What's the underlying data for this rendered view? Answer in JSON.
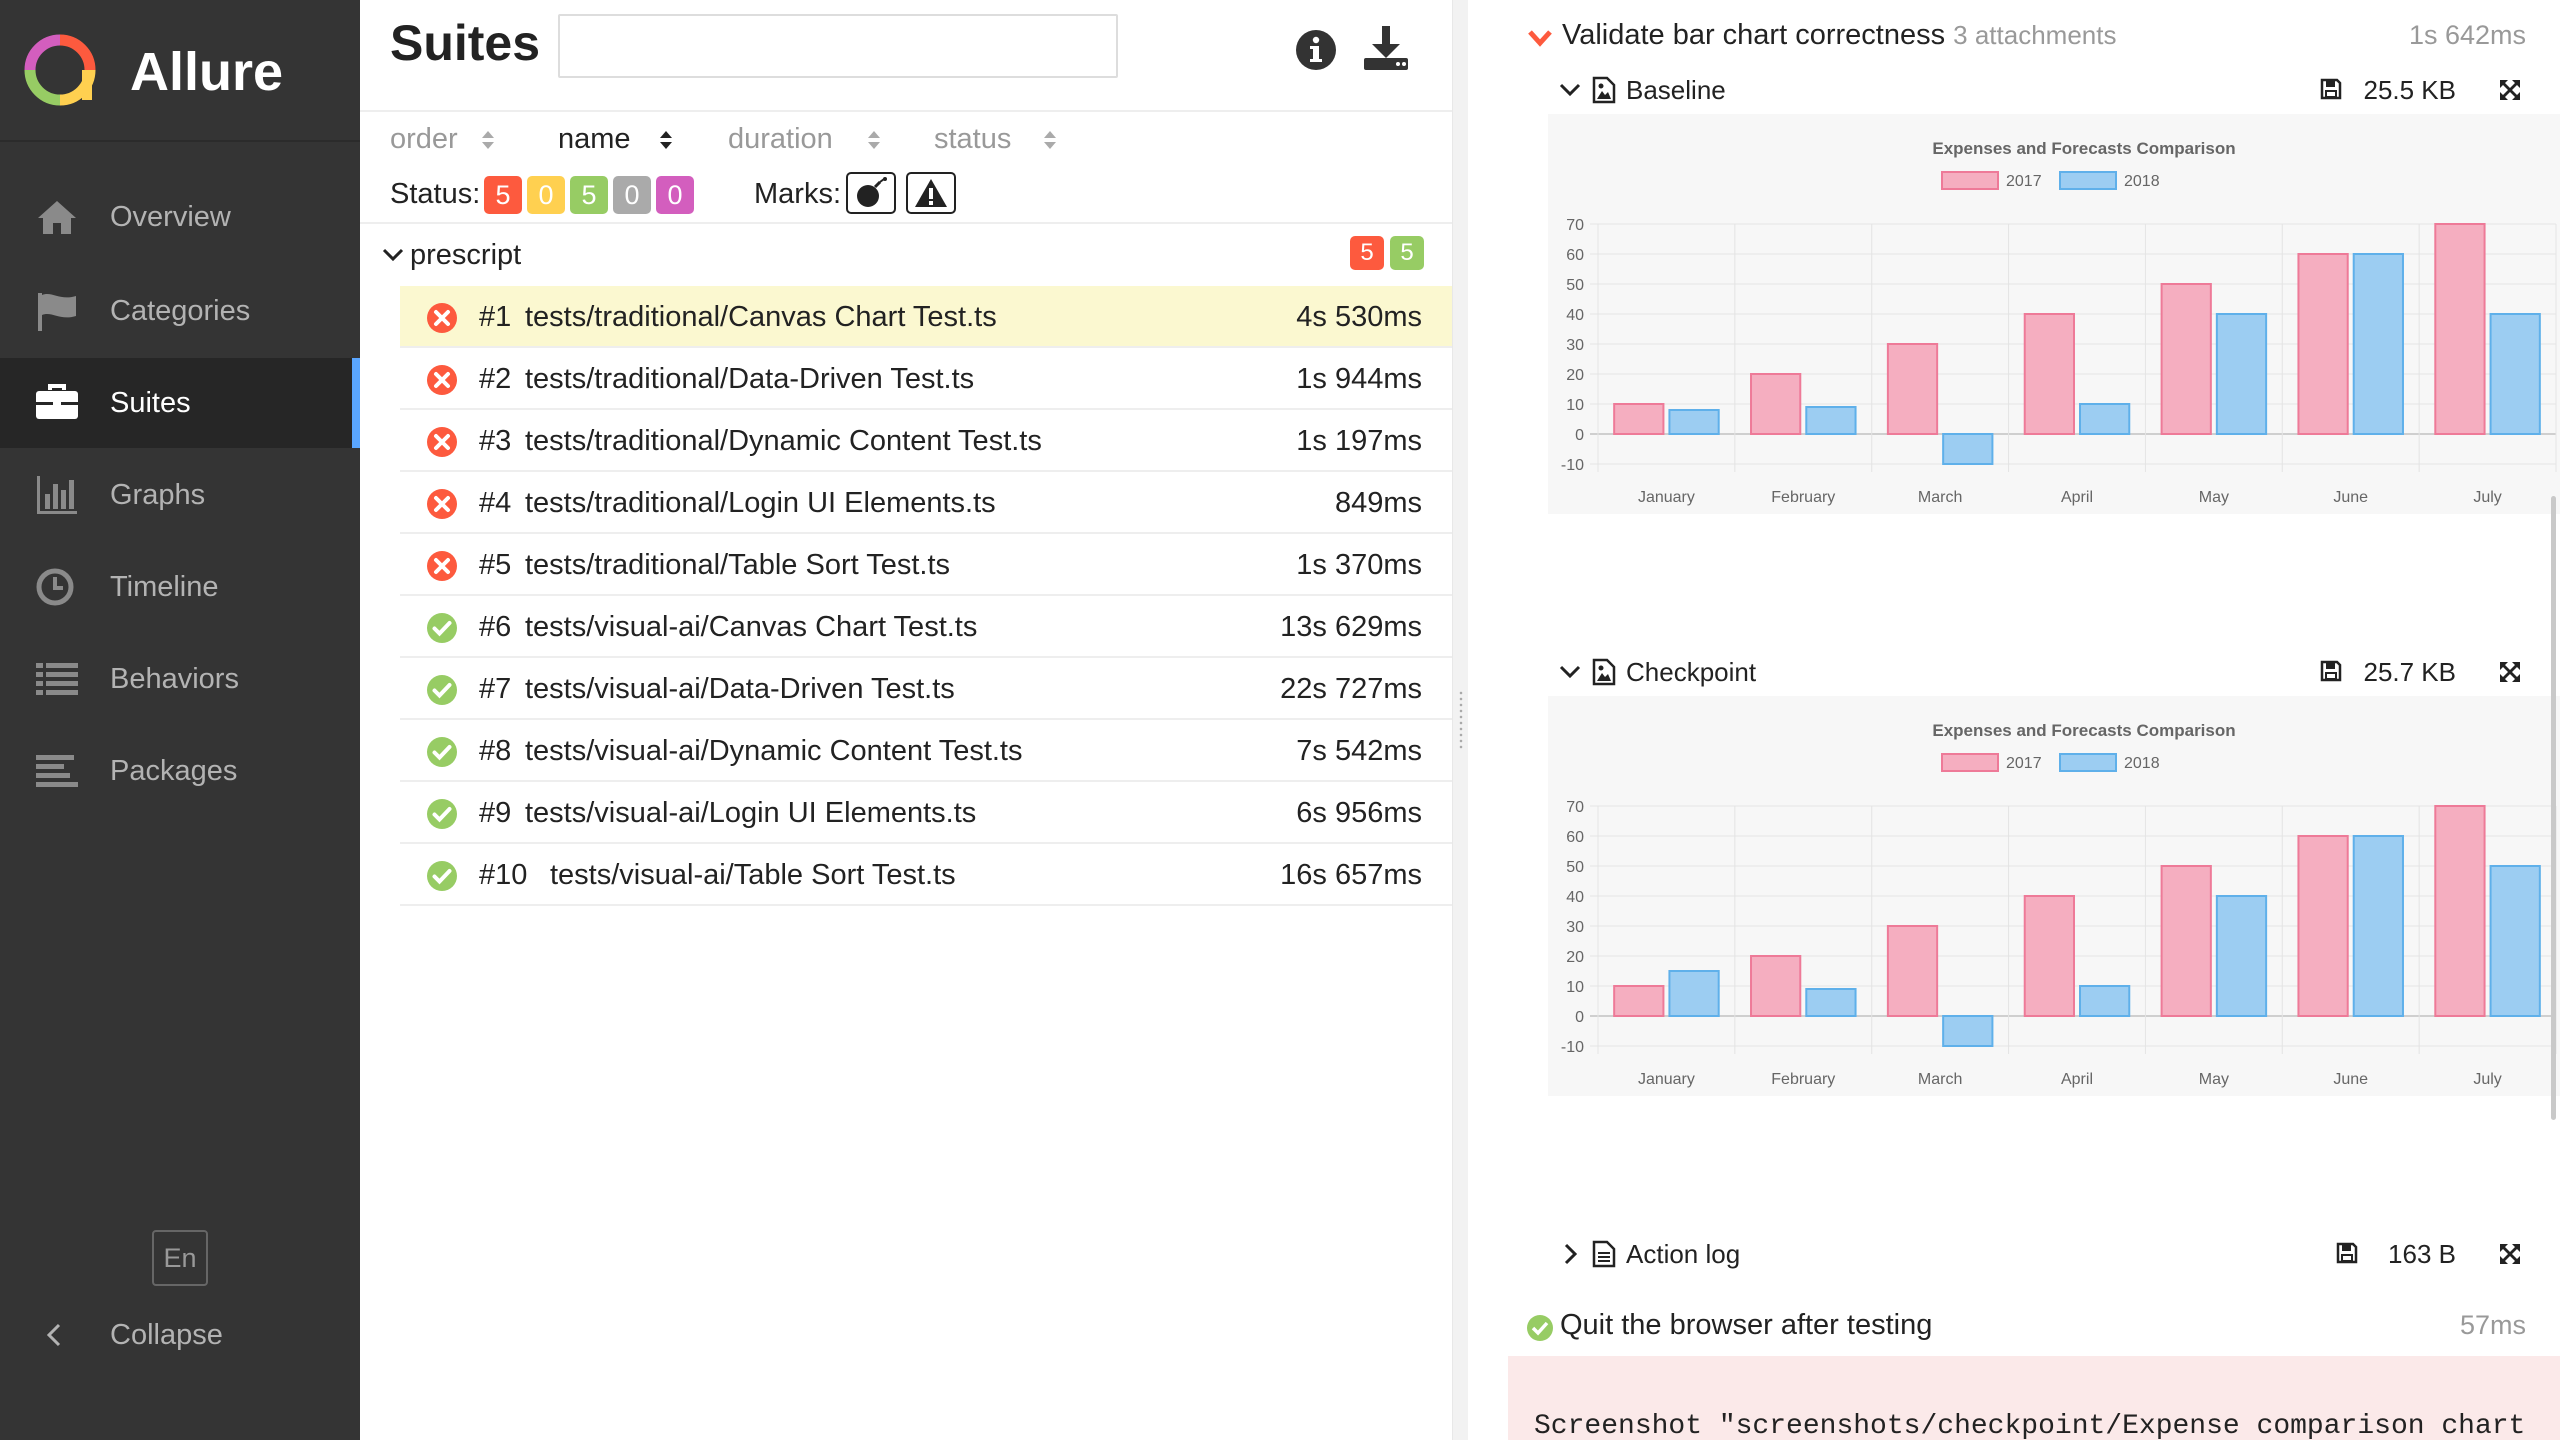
{
  "brand": {
    "name": "Allure"
  },
  "sidebar": {
    "items": [
      {
        "label": "Overview",
        "icon": "home-icon"
      },
      {
        "label": "Categories",
        "icon": "flag-icon"
      },
      {
        "label": "Suites",
        "icon": "briefcase-icon",
        "active": true
      },
      {
        "label": "Graphs",
        "icon": "bar-chart-icon"
      },
      {
        "label": "Timeline",
        "icon": "clock-icon"
      },
      {
        "label": "Behaviors",
        "icon": "list-icon"
      },
      {
        "label": "Packages",
        "icon": "align-left-icon"
      }
    ],
    "language": "En",
    "collapse_label": "Collapse"
  },
  "suites": {
    "title": "Suites",
    "search_value": "",
    "sort": {
      "order": "order",
      "name": "name",
      "duration": "duration",
      "status": "status",
      "active": "name"
    },
    "status_label": "Status:",
    "status_counts": [
      {
        "name": "failed",
        "count": "5",
        "color": "#fd5a3e"
      },
      {
        "name": "broken",
        "count": "0",
        "color": "#ffd050"
      },
      {
        "name": "passed",
        "count": "5",
        "color": "#97cc64"
      },
      {
        "name": "skipped",
        "count": "0",
        "color": "#aaaaaa"
      },
      {
        "name": "unknown",
        "count": "0",
        "color": "#d35ebe"
      }
    ],
    "marks_label": "Marks:",
    "group": {
      "name": "prescript",
      "failed": "5",
      "passed": "5"
    },
    "tests": [
      {
        "index": "#1",
        "name": "tests/traditional/Canvas Chart Test.ts",
        "duration": "4s 530ms",
        "status": "failed",
        "selected": true
      },
      {
        "index": "#2",
        "name": "tests/traditional/Data-Driven Test.ts",
        "duration": "1s 944ms",
        "status": "failed"
      },
      {
        "index": "#3",
        "name": "tests/traditional/Dynamic Content Test.ts",
        "duration": "1s 197ms",
        "status": "failed"
      },
      {
        "index": "#4",
        "name": "tests/traditional/Login UI Elements.ts",
        "duration": "849ms",
        "status": "failed"
      },
      {
        "index": "#5",
        "name": "tests/traditional/Table Sort Test.ts",
        "duration": "1s 370ms",
        "status": "failed"
      },
      {
        "index": "#6",
        "name": "tests/visual-ai/Canvas Chart Test.ts",
        "duration": "13s 629ms",
        "status": "passed"
      },
      {
        "index": "#7",
        "name": "tests/visual-ai/Data-Driven Test.ts",
        "duration": "22s 727ms",
        "status": "passed"
      },
      {
        "index": "#8",
        "name": "tests/visual-ai/Dynamic Content Test.ts",
        "duration": "7s 542ms",
        "status": "passed"
      },
      {
        "index": "#9",
        "name": "tests/visual-ai/Login UI Elements.ts",
        "duration": "6s 956ms",
        "status": "passed"
      },
      {
        "index": "#10",
        "name": "tests/visual-ai/Table Sort Test.ts",
        "duration": "16s 657ms",
        "status": "passed"
      }
    ]
  },
  "details": {
    "step1": {
      "title": "Validate bar chart correctness",
      "attachments_label": "3 attachments",
      "duration": "1s 642ms"
    },
    "baseline": {
      "name": "Baseline",
      "size": "25.5 KB"
    },
    "checkpoint": {
      "name": "Checkpoint",
      "size": "25.7 KB"
    },
    "action_log": {
      "name": "Action log",
      "size": "163 B"
    },
    "step2": {
      "title": "Quit the browser after testing",
      "duration": "57ms"
    },
    "log_text": "Screenshot \"screenshots/checkpoint/Expense comparison chart"
  },
  "colors": {
    "failed": "#fd5a3e",
    "passed": "#97cc64",
    "accent": "#5aa6ff",
    "series_2017_fill": "#f5aec0",
    "series_2017_stroke": "#ee7a98",
    "series_2018_fill": "#9ccdf2",
    "series_2018_stroke": "#5fb0ea"
  },
  "chart_data": [
    {
      "type": "bar",
      "title": "Expenses and Forecasts Comparison",
      "categories": [
        "January",
        "February",
        "March",
        "April",
        "May",
        "June",
        "July"
      ],
      "series": [
        {
          "name": "2017",
          "values": [
            10,
            20,
            30,
            40,
            50,
            60,
            70
          ]
        },
        {
          "name": "2018",
          "values": [
            8,
            9,
            -10,
            10,
            40,
            60,
            40
          ]
        }
      ],
      "ylim": [
        -10,
        70
      ],
      "yticks": [
        -10,
        0,
        10,
        20,
        30,
        40,
        50,
        60,
        70
      ],
      "legend": "top",
      "grid": true
    },
    {
      "type": "bar",
      "title": "Expenses and Forecasts Comparison",
      "categories": [
        "January",
        "February",
        "March",
        "April",
        "May",
        "June",
        "July"
      ],
      "series": [
        {
          "name": "2017",
          "values": [
            10,
            20,
            30,
            40,
            50,
            60,
            70
          ]
        },
        {
          "name": "2018",
          "values": [
            15,
            9,
            -10,
            10,
            40,
            60,
            50
          ]
        }
      ],
      "ylim": [
        -10,
        70
      ],
      "yticks": [
        -10,
        0,
        10,
        20,
        30,
        40,
        50,
        60,
        70
      ],
      "legend": "top",
      "grid": true
    }
  ]
}
